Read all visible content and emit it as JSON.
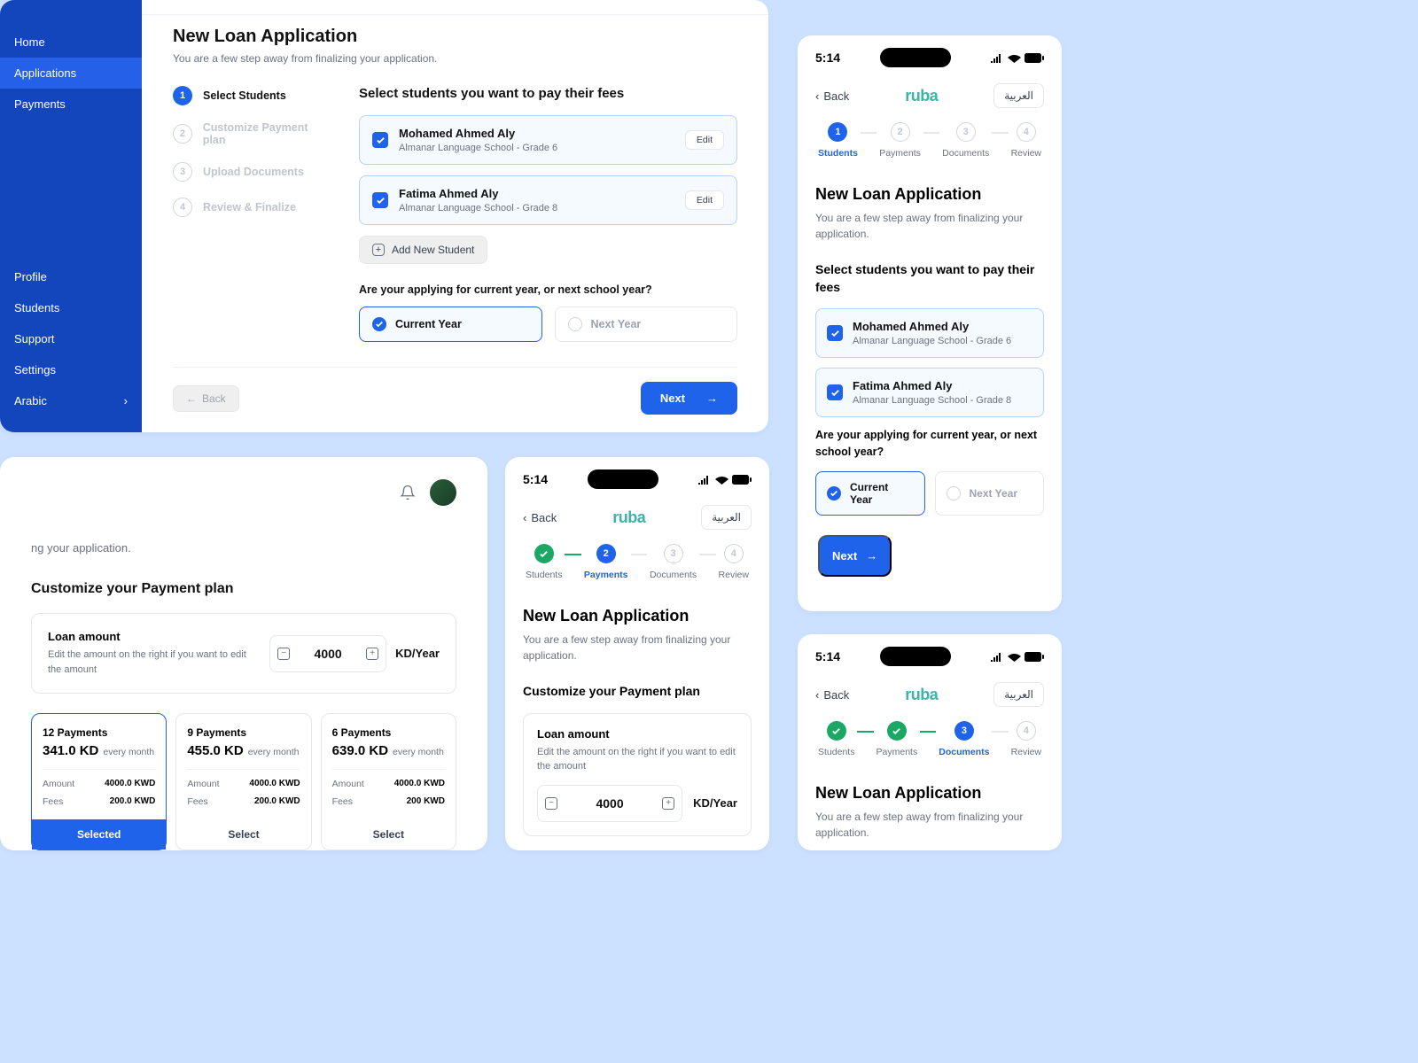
{
  "app": {
    "title": "New Loan Application",
    "subtitle": "You are a few step away from finalizing your application.",
    "subtitle_frag": "ng your application."
  },
  "sidebar": {
    "items": [
      "Home",
      "Applications",
      "Payments"
    ],
    "items2": [
      "Profile",
      "Students",
      "Support",
      "Settings"
    ],
    "lang": "Arabic"
  },
  "vsteps": [
    {
      "n": "1",
      "label": "Select Students"
    },
    {
      "n": "2",
      "label": "Customize Payment plan"
    },
    {
      "n": "3",
      "label": "Upload Documents"
    },
    {
      "n": "4",
      "label": "Review & Finalize"
    }
  ],
  "hsteps": [
    "Students",
    "Payments",
    "Documents",
    "Review"
  ],
  "select_title": "Select students you want to pay their fees",
  "students": [
    {
      "name": "Mohamed Ahmed Aly",
      "school": "Almanar Language School - Grade 6"
    },
    {
      "name": "Fatima Ahmed Aly",
      "school": "Almanar Language School - Grade 8"
    }
  ],
  "edit": "Edit",
  "add_student": "Add New Student",
  "year_q": "Are your applying for current year, or next school year?",
  "current_year": "Current Year",
  "next_year": "Next Year",
  "back": "Back",
  "next": "Next",
  "mobile": {
    "time": "5:14",
    "back": "Back",
    "logo": "ruba",
    "lang": "العربية"
  },
  "payment": {
    "title": "Customize your Payment plan",
    "loan_label": "Loan amount",
    "loan_hint": "Edit the amount on the right if you want to edit the amount",
    "amount": "4000",
    "unit": "KD/Year",
    "selected": "Selected",
    "select": "Select"
  },
  "plans": [
    {
      "title": "12 Payments",
      "price": "341.0 KD",
      "period": "every month",
      "amount": "4000.0 KWD",
      "fees": "200.0 KWD"
    },
    {
      "title": "9 Payments",
      "price": "455.0 KD",
      "period": "every month",
      "amount": "4000.0 KWD",
      "fees": "200.0 KWD"
    },
    {
      "title": "6 Payments",
      "price": "639.0 KD",
      "period": "every month",
      "amount": "4000.0 KWD",
      "fees": "200 KWD"
    }
  ],
  "labels": {
    "amount": "Amount",
    "fees": "Fees"
  }
}
